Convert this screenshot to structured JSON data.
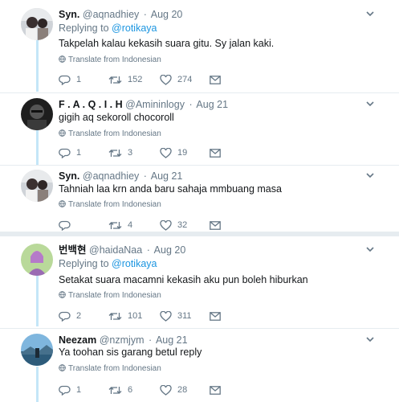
{
  "tweets": [
    {
      "name": "Syn.",
      "handle": "@aqnadhiey",
      "date": "Aug 20",
      "replying_label": "Replying to",
      "replying_to": "@rotikaya",
      "text": "Takpelah kalau kekasih suara gitu. Sy jalan kaki.",
      "translate": "Translate from Indonesian",
      "replies": "1",
      "retweets": "152",
      "likes": "274"
    },
    {
      "name": "F . A . Q . I . H",
      "handle": "@Amininlogy",
      "date": "Aug 21",
      "text": "gigih aq sekoroll chocoroll",
      "translate": "Translate from Indonesian",
      "replies": "1",
      "retweets": "3",
      "likes": "19"
    },
    {
      "name": "Syn.",
      "handle": "@aqnadhiey",
      "date": "Aug 21",
      "text": "Tahniah laa krn anda baru sahaja mmbuang masa",
      "translate": "Translate from Indonesian",
      "replies": "",
      "retweets": "4",
      "likes": "32"
    },
    {
      "name": "번백현",
      "handle": "@haidaNaa",
      "date": "Aug 20",
      "replying_label": "Replying to",
      "replying_to": "@rotikaya",
      "text": "Setakat suara macamni kekasih aku pun boleh hiburkan",
      "translate": "Translate from Indonesian",
      "replies": "2",
      "retweets": "101",
      "likes": "311"
    },
    {
      "name": "Neezam",
      "handle": "@nzmjym",
      "date": "Aug 21",
      "text": "Ya toohan sis garang betul reply",
      "translate": "Translate from Indonesian",
      "replies": "1",
      "retweets": "6",
      "likes": "28"
    }
  ],
  "colors": {
    "thread_line": "#c4e6f8",
    "mention": "#1b95e0",
    "muted": "#657786",
    "divider": "#e6ecf0"
  },
  "icons": [
    "chevron-down-icon",
    "globe-icon",
    "reply-icon",
    "retweet-icon",
    "like-icon",
    "message-icon"
  ]
}
